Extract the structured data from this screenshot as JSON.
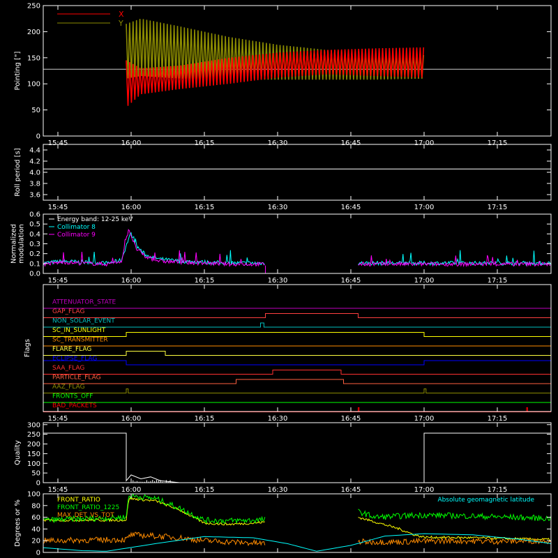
{
  "time_axis": {
    "tick_labels": [
      "15:45",
      "16:00",
      "16:15",
      "16:30",
      "16:45",
      "17:00",
      "17:15"
    ],
    "tick_minutes": [
      945,
      960,
      975,
      990,
      1005,
      1020,
      1035
    ],
    "range_minutes": [
      942,
      1046
    ]
  },
  "colors": {
    "red": "#ff0000",
    "olive": "#8b8b00",
    "cyan": "#00ffff",
    "magenta": "#ff00ff",
    "white": "#ffffff",
    "yellow": "#ffff00",
    "green": "#00ff00",
    "orange": "#ff8c00",
    "blue": "#0000ff",
    "purple": "#c000c0",
    "salmon": "#ff6050"
  },
  "chart_data": [
    {
      "id": "pointing",
      "type": "line",
      "ylabel": "Pointing [\"]",
      "ylim": [
        0,
        250
      ],
      "yticks": [
        "0",
        "50",
        "100",
        "150",
        "200",
        "250"
      ],
      "ytick_values": [
        0,
        50,
        100,
        150,
        200,
        250
      ],
      "reference_level": 128,
      "series": [
        {
          "name": "X",
          "color": "#ff0000",
          "envelope": {
            "t": [
              959,
              962,
              970,
              980,
              990,
              1000,
              1010,
              1020
            ],
            "lo": [
              55,
              80,
              90,
              100,
              112,
              118,
              115,
              112
            ],
            "hi": [
              145,
              130,
              135,
              150,
              160,
              165,
              168,
              170
            ]
          }
        },
        {
          "name": "Y",
          "color": "#8b8b00",
          "envelope": {
            "t": [
              959,
              962,
              970,
              980,
              990,
              1000,
              1010,
              1020
            ],
            "lo": [
              110,
              115,
              110,
              108,
              108,
              108,
              108,
              110
            ],
            "hi": [
              215,
              225,
              210,
              190,
              175,
              165,
              160,
              155
            ]
          }
        }
      ],
      "active_range": [
        959,
        1020
      ]
    },
    {
      "id": "roll",
      "type": "line",
      "ylabel": "Roll period [s]",
      "ylim": [
        3.5,
        4.5
      ],
      "yticks": [
        "3.6",
        "3.8",
        "4.0",
        "4.2",
        "4.4"
      ],
      "ytick_values": [
        3.6,
        3.8,
        4.0,
        4.2,
        4.4
      ],
      "series": [
        {
          "name": "",
          "color": "#ffffff",
          "x": [
            942,
            1046
          ],
          "y": [
            4.06,
            4.06
          ]
        }
      ]
    },
    {
      "id": "modulation",
      "type": "line",
      "ylabel": [
        "Normalized",
        "modulation"
      ],
      "ylim": [
        0,
        0.6
      ],
      "yticks": [
        "0.0",
        "0.1",
        "0.2",
        "0.3",
        "0.4",
        "0.5",
        "0.6"
      ],
      "ytick_values": [
        0,
        0.1,
        0.2,
        0.3,
        0.4,
        0.5,
        0.6
      ],
      "legend": [
        "Energy band: 12-25 keV",
        "Collimator 8",
        "Collimator 9"
      ],
      "legend_colors": [
        "#ffffff",
        "#00ffff",
        "#ff00ff"
      ],
      "series": [
        {
          "name": "Collimator 8",
          "color": "#00ffff",
          "x": [
            942,
            946,
            950,
            955,
            958,
            959.5,
            960,
            961,
            963,
            966,
            970,
            975,
            980,
            985,
            990,
            987.5
          ],
          "y": [
            0.1,
            0.12,
            0.11,
            0.1,
            0.13,
            0.35,
            0.4,
            0.28,
            0.18,
            0.14,
            0.12,
            0.11,
            0.1,
            0.1,
            0.1,
            0.1
          ]
        },
        {
          "name": "Collimator 9",
          "color": "#ff00ff",
          "x": [
            942,
            946,
            950,
            955,
            958,
            959.5,
            960,
            961,
            963,
            966,
            970,
            975,
            980,
            985,
            987.5
          ],
          "y": [
            0.09,
            0.11,
            0.1,
            0.09,
            0.12,
            0.45,
            0.38,
            0.25,
            0.16,
            0.12,
            0.11,
            0.1,
            0.09,
            0.09,
            0.09
          ]
        }
      ],
      "gap_range": [
        987.5,
        1006.5
      ]
    },
    {
      "id": "flags",
      "type": "line",
      "ylabel": "Flags",
      "flags": [
        {
          "name": "ATTENUATOR_STATE",
          "color": "#c000c0",
          "steps": [
            [
              942,
              0
            ],
            [
              1046,
              0
            ]
          ]
        },
        {
          "name": "GAP_FLAG",
          "color": "#ff4040",
          "steps": [
            [
              942,
              0
            ],
            [
              987.5,
              1
            ],
            [
              1006.5,
              0
            ],
            [
              1046,
              0
            ]
          ]
        },
        {
          "name": "NON_SOLAR_EVENT",
          "color": "#00c0c0",
          "steps": [
            [
              942,
              0
            ],
            [
              986.5,
              1
            ],
            [
              987.2,
              0
            ],
            [
              1046,
              0
            ]
          ]
        },
        {
          "name": "SC_IN_SUNLIGHT",
          "color": "#ffff00",
          "steps": [
            [
              942,
              0
            ],
            [
              959,
              1
            ],
            [
              1020,
              0
            ],
            [
              1046,
              0
            ]
          ]
        },
        {
          "name": "SC_TRANSMITTER",
          "color": "#ff8c00",
          "steps": [
            [
              942,
              0
            ],
            [
              1046,
              0
            ]
          ]
        },
        {
          "name": "FLARE_FLAG",
          "color": "#ffff40",
          "steps": [
            [
              942,
              0
            ],
            [
              959,
              1
            ],
            [
              967,
              0
            ],
            [
              1046,
              0
            ]
          ]
        },
        {
          "name": "ECLIPSE_FLAG",
          "color": "#0000ff",
          "steps": [
            [
              942,
              1
            ],
            [
              959,
              0
            ],
            [
              1020,
              1
            ],
            [
              1046,
              1
            ]
          ]
        },
        {
          "name": "SAA_FLAG",
          "color": "#ff3030",
          "steps": [
            [
              942,
              0
            ],
            [
              989,
              1
            ],
            [
              1003,
              0
            ],
            [
              1046,
              0
            ]
          ]
        },
        {
          "name": "PARTICLE_FLAG",
          "color": "#ff6040",
          "steps": [
            [
              942,
              0
            ],
            [
              981.5,
              1
            ],
            [
              1003.5,
              0
            ],
            [
              1046,
              0
            ]
          ]
        },
        {
          "name": "AAZ_FLAG",
          "color": "#8b8b00",
          "steps": [
            [
              942,
              0
            ],
            [
              959,
              1
            ],
            [
              959.4,
              0
            ],
            [
              1020,
              1
            ],
            [
              1020.4,
              0
            ],
            [
              1046,
              0
            ]
          ]
        },
        {
          "name": "FRONTS_OFF",
          "color": "#00ff00",
          "steps": [
            [
              942,
              0
            ],
            [
              1046,
              0
            ]
          ]
        },
        {
          "name": "BAD_PACKETS",
          "color": "#ff0000",
          "steps": [
            [
              942,
              0
            ],
            [
              1006.5,
              1
            ],
            [
              1006.7,
              0
            ],
            [
              1041,
              1
            ],
            [
              1041.2,
              0
            ],
            [
              1046,
              0
            ]
          ]
        }
      ]
    },
    {
      "id": "quality",
      "type": "line",
      "ylabel": "Quality",
      "ylim": [
        0,
        310
      ],
      "yticks": [
        "0",
        "50",
        "100",
        "150",
        "200",
        "250",
        "300"
      ],
      "ytick_values": [
        0,
        50,
        100,
        150,
        200,
        250,
        300
      ],
      "series": [
        {
          "name": "",
          "color": "#ffffff",
          "x": [
            942,
            959,
            959,
            960,
            962,
            964,
            966,
            968,
            970,
            1020,
            1020,
            1046
          ],
          "y": [
            256,
            256,
            10,
            40,
            20,
            30,
            10,
            5,
            0,
            0,
            256,
            256
          ]
        }
      ]
    },
    {
      "id": "ratios",
      "type": "line",
      "ylabel": "Degrees or %",
      "ylim": [
        0,
        100
      ],
      "yticks": [
        "0",
        "20",
        "40",
        "60",
        "80",
        "100"
      ],
      "ytick_values": [
        0,
        20,
        40,
        60,
        80,
        100
      ],
      "legend": [
        "FRONT_RATIO",
        "FRONT_RATIO_1225",
        "MAX_DET_VS_TOT"
      ],
      "legend_colors": [
        "#ffff00",
        "#00ff00",
        "#ff8c00"
      ],
      "annotation": "Absolute geomagnetic latitude",
      "annotation_color": "#00ffff",
      "series": [
        {
          "name": "FRONT_RATIO",
          "color": "#ffff00",
          "x": [
            942,
            959,
            959.5,
            965,
            970,
            975,
            980,
            985,
            987.5,
            1006.5,
            1010,
            1015,
            1018,
            1020,
            1030,
            1046
          ],
          "y": [
            55,
            55,
            92,
            88,
            72,
            50,
            48,
            50,
            52,
            60,
            52,
            40,
            30,
            26,
            25,
            22
          ]
        },
        {
          "name": "FRONT_RATIO_1225",
          "color": "#00ff00",
          "x": [
            942,
            959,
            959.5,
            965,
            970,
            975,
            980,
            985,
            987.5,
            1006.5,
            1010,
            1020,
            1030,
            1046
          ],
          "y": [
            55,
            60,
            97,
            92,
            75,
            55,
            54,
            55,
            56,
            70,
            60,
            64,
            62,
            58
          ]
        },
        {
          "name": "MAX_DET_VS_TOT",
          "color": "#ff8c00",
          "x": [
            942,
            959,
            960,
            965,
            970,
            975,
            980,
            985,
            987.5,
            1006.5,
            1015,
            1025,
            1035,
            1046
          ],
          "y": [
            20,
            22,
            30,
            28,
            25,
            20,
            18,
            16,
            15,
            18,
            18,
            20,
            19,
            20
          ]
        },
        {
          "name": "Absolute geomagnetic latitude",
          "color": "#00ffff",
          "x": [
            942,
            950,
            955,
            965,
            975,
            985,
            992,
            998,
            1005,
            1012,
            1020,
            1030,
            1040,
            1046
          ],
          "y": [
            8,
            3,
            2,
            15,
            27,
            25,
            15,
            2,
            12,
            28,
            32,
            30,
            22,
            15
          ]
        }
      ],
      "gap_range": [
        987.5,
        1006.5
      ]
    }
  ]
}
